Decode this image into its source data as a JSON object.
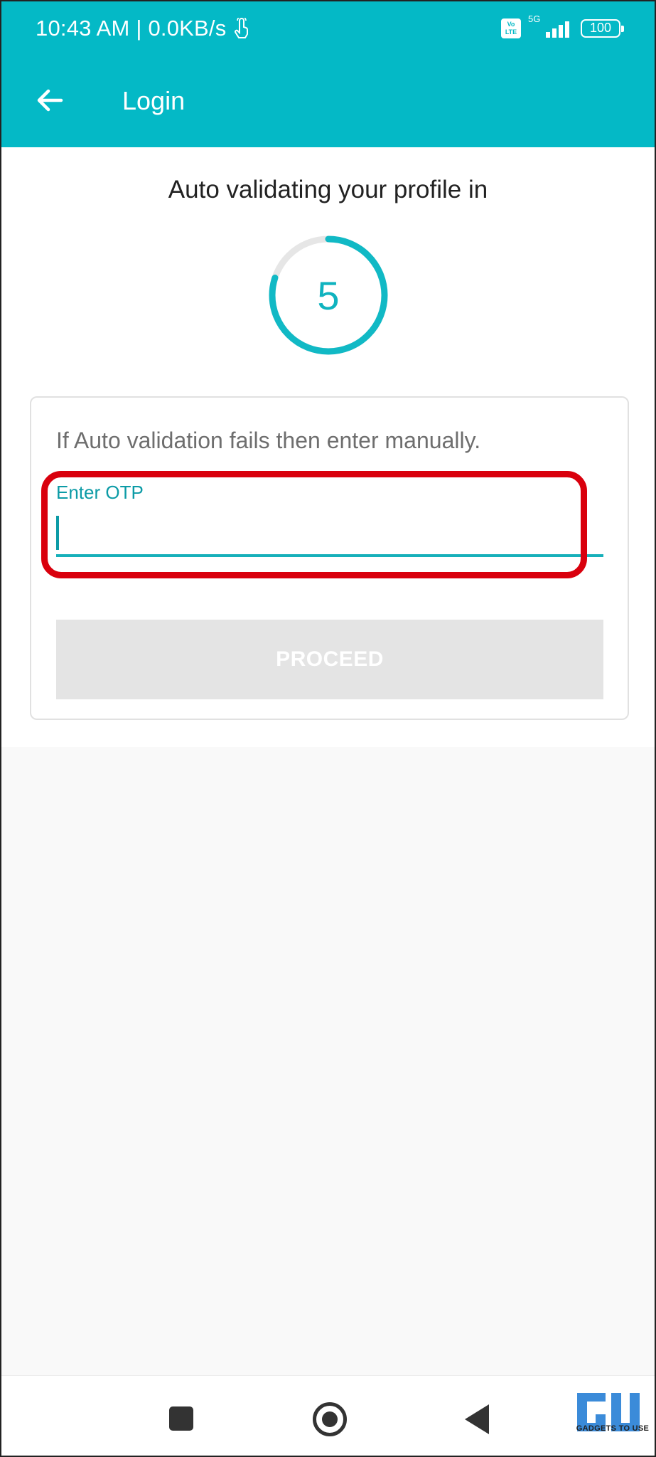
{
  "status_bar": {
    "time_speed": "10:43 AM | 0.0KB/s",
    "volte": "Vo LTE",
    "network": "5G",
    "battery": "100"
  },
  "app_bar": {
    "title": "Login",
    "back_icon": "arrow-left-icon"
  },
  "main": {
    "auto_validate_text": "Auto validating your profile in",
    "countdown_value": "5",
    "countdown_progress": 0.8,
    "card": {
      "hint": "If Auto validation fails then enter manually.",
      "otp_label": "Enter OTP",
      "otp_value": "",
      "proceed_label": "PROCEED"
    }
  },
  "nav_bar": {
    "recents_icon": "square-icon",
    "home_icon": "circle-icon",
    "back_icon": "triangle-back-icon"
  },
  "watermark": {
    "text": "GADGETS TO USE"
  },
  "colors": {
    "primary": "#04b9c6",
    "accent": "#0c9ba6",
    "highlight": "#d9000d",
    "disabled_button": "#e4e4e4"
  }
}
